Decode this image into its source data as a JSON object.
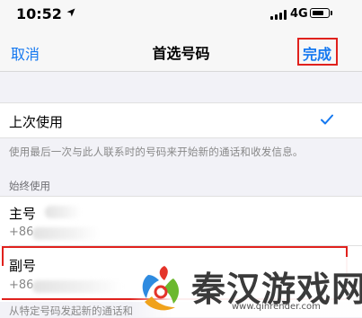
{
  "status_bar": {
    "time": "10:52",
    "network": "4G",
    "icons": [
      "location-arrow-icon",
      "signal-bars-icon",
      "battery-icon"
    ]
  },
  "navbar": {
    "cancel_label": "取消",
    "title": "首选号码",
    "done_label": "完成"
  },
  "recent": {
    "label": "上次使用",
    "selected": true,
    "description": "使用最后一次与此人联系时的号码来开始新的通话和收发信息。"
  },
  "always_use": {
    "header": "始终使用",
    "options": [
      {
        "label": "主号",
        "number_prefix": "+86"
      },
      {
        "label": "副号",
        "number_prefix": "+86"
      }
    ],
    "footer_description": "从特定号码发起新的通话和"
  },
  "watermark": {
    "text": "秦汉游戏网",
    "url": "www.qinrender.com"
  },
  "colors": {
    "accent": "#1478f0",
    "highlight": "#e0211d",
    "background": "#f2f2f7"
  }
}
